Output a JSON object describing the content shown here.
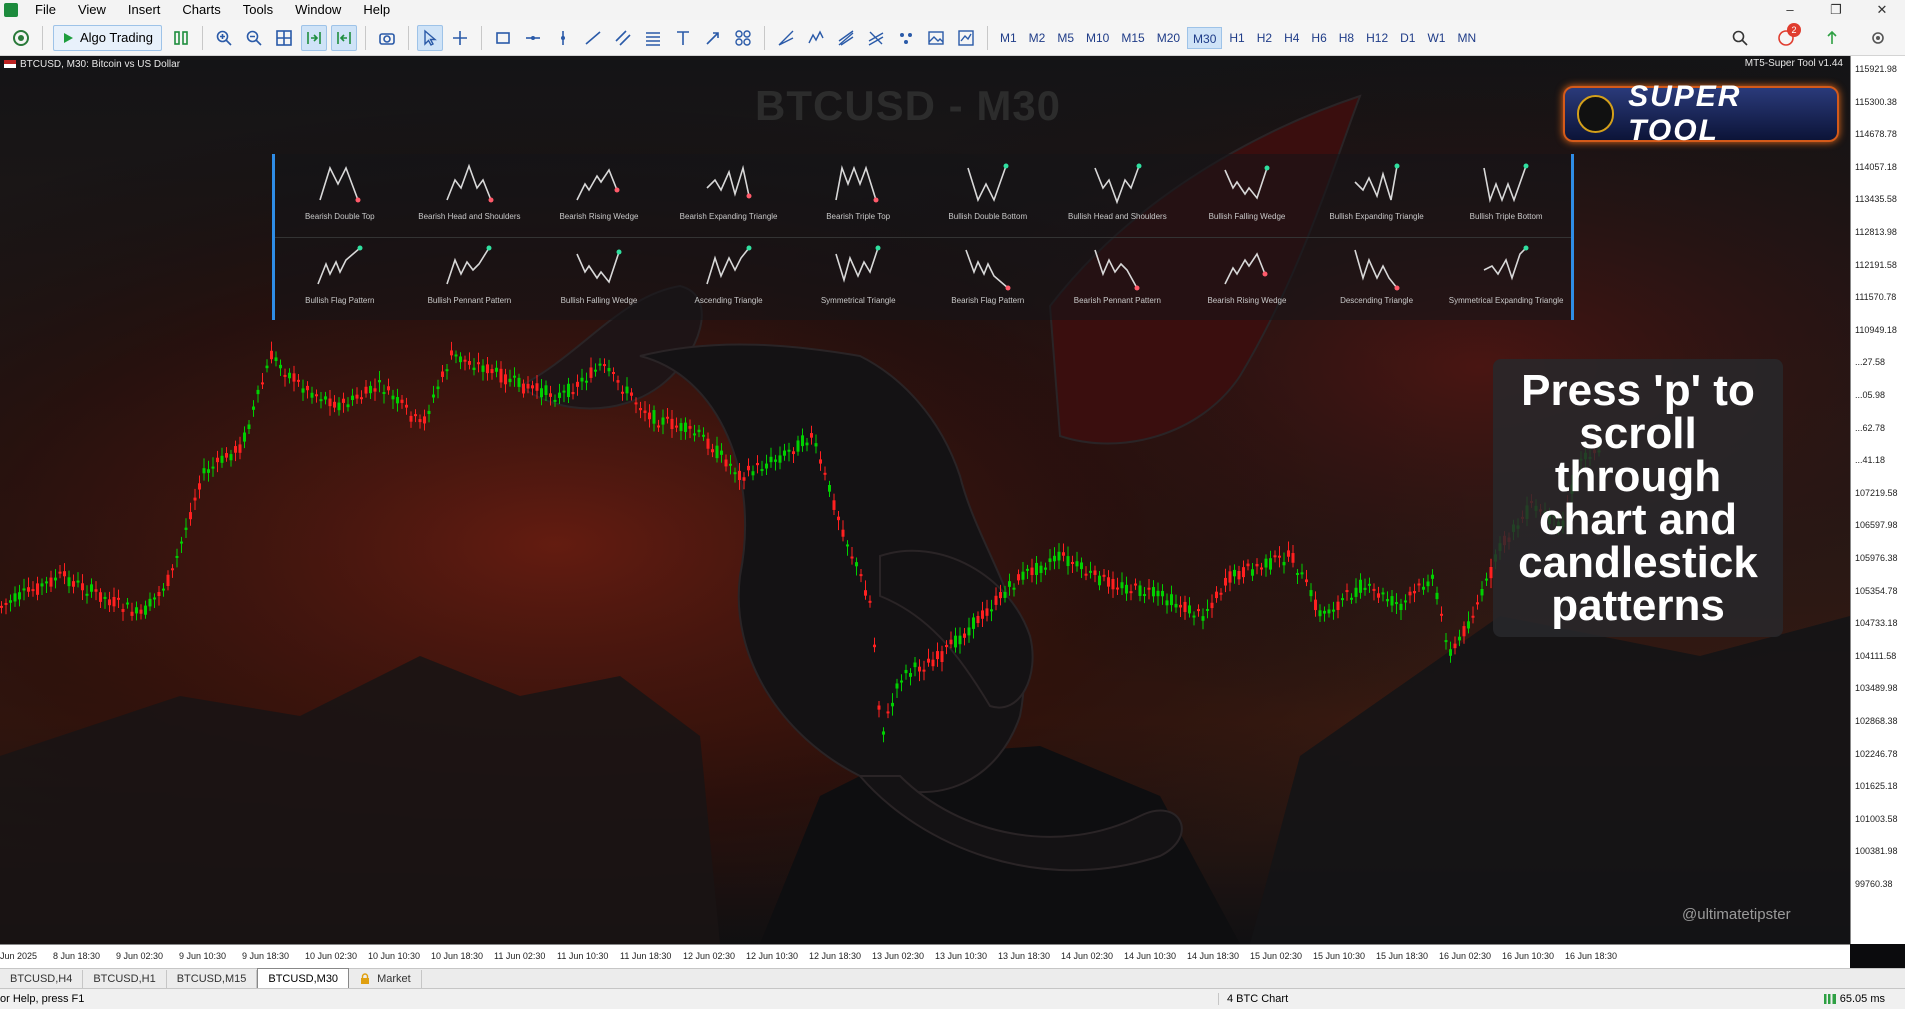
{
  "menu": [
    "File",
    "View",
    "Insert",
    "Charts",
    "Tools",
    "Window",
    "Help"
  ],
  "toolbar": {
    "algo_label": "Algo Trading",
    "timeframes": [
      "M1",
      "M2",
      "M5",
      "M10",
      "M15",
      "M20",
      "M30",
      "H1",
      "H2",
      "H4",
      "H6",
      "H8",
      "H12",
      "D1",
      "W1",
      "MN"
    ],
    "active_timeframe": "M30",
    "notification_count": "2"
  },
  "chart": {
    "header": "BTCUSD, M30:  Bitcoin vs US Dollar",
    "ea_name": "MT5-Super Tool v1.44",
    "big_title": "BTCUSD - M30",
    "logo_text": "SUPER TOOL",
    "press_text": "Press 'p' to scroll through chart and candlestick patterns",
    "watermark": "@ultimatetipster",
    "bull_color": "#00d000",
    "bear_color": "#ff2020"
  },
  "patterns_row1": [
    {
      "label": "Bearish Double Top",
      "icon": "double-top"
    },
    {
      "label": "Bearish Head and Shoulders",
      "icon": "head-shoulders"
    },
    {
      "label": "Bearish Rising Wedge",
      "icon": "rising-wedge"
    },
    {
      "label": "Bearish Expanding Triangle",
      "icon": "expanding-triangle"
    },
    {
      "label": "Bearish Triple Top",
      "icon": "triple-top"
    },
    {
      "label": "Bullish Double Bottom",
      "icon": "double-bottom"
    },
    {
      "label": "Bullish Head and Shoulders",
      "icon": "inv-head-shoulders"
    },
    {
      "label": "Bullish Falling Wedge",
      "icon": "falling-wedge"
    },
    {
      "label": "Bullish Expanding Triangle",
      "icon": "expanding-triangle-bull"
    },
    {
      "label": "Bullish Triple Bottom",
      "icon": "triple-bottom"
    }
  ],
  "patterns_row2": [
    {
      "label": "Bullish Flag Pattern",
      "icon": "bull-flag"
    },
    {
      "label": "Bullish Pennant Pattern",
      "icon": "bull-pennant"
    },
    {
      "label": "Bullish Falling Wedge",
      "icon": "falling-wedge"
    },
    {
      "label": "Ascending Triangle",
      "icon": "ascending-triangle"
    },
    {
      "label": "Symmetrical Triangle",
      "icon": "symmetrical-triangle"
    },
    {
      "label": "Bearish Flag Pattern",
      "icon": "bear-flag"
    },
    {
      "label": "Bearish Pennant Pattern",
      "icon": "bear-pennant"
    },
    {
      "label": "Bearish Rising Wedge",
      "icon": "rising-wedge"
    },
    {
      "label": "Descending Triangle",
      "icon": "descending-triangle"
    },
    {
      "label": "Symmetrical Expanding Triangle",
      "icon": "sym-expanding"
    }
  ],
  "y_ticks": [
    "115921.98",
    "115300.38",
    "114678.78",
    "114057.18",
    "113435.58",
    "112813.98",
    "112191.58",
    "111570.78",
    "110949.18",
    "...27.58",
    "...05.98",
    "...62.78",
    "...41.18",
    "107219.58",
    "106597.98",
    "105976.38",
    "105354.78",
    "104733.18",
    "104111.58",
    "103489.98",
    "102868.38",
    "102246.78",
    "101625.18",
    "101003.58",
    "100381.98",
    "99760.38"
  ],
  "x_ticks": [
    "Jun 2025",
    "8 Jun 18:30",
    "9 Jun 02:30",
    "9 Jun 10:30",
    "9 Jun 18:30",
    "10 Jun 02:30",
    "10 Jun 10:30",
    "10 Jun 18:30",
    "11 Jun 02:30",
    "11 Jun 10:30",
    "11 Jun 18:30",
    "12 Jun 02:30",
    "12 Jun 10:30",
    "12 Jun 18:30",
    "13 Jun 02:30",
    "13 Jun 10:30",
    "13 Jun 18:30",
    "14 Jun 02:30",
    "14 Jun 10:30",
    "14 Jun 18:30",
    "15 Jun 02:30",
    "15 Jun 10:30",
    "15 Jun 18:30",
    "16 Jun 02:30",
    "16 Jun 10:30",
    "16 Jun 18:30"
  ],
  "tabs": [
    "BTCUSD,H4",
    "BTCUSD,H1",
    "BTCUSD,M15",
    "BTCUSD,M30",
    "Market"
  ],
  "active_tab": "BTCUSD,M30",
  "status": {
    "help": "or Help, press F1",
    "profile": "4 BTC Chart",
    "ping": "65.05 ms"
  }
}
